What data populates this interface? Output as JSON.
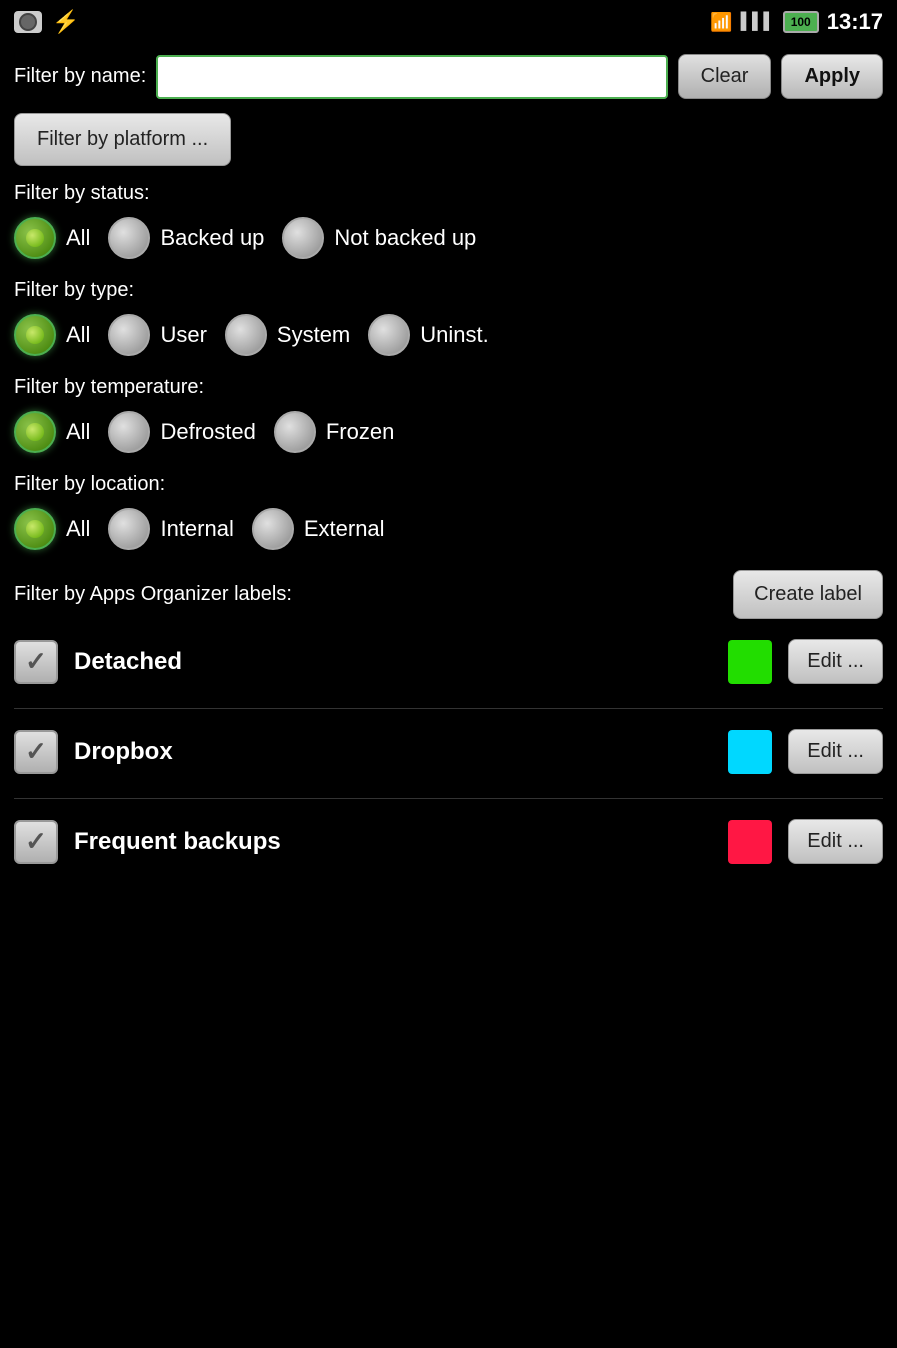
{
  "statusBar": {
    "time": "13:17",
    "battery": "100"
  },
  "header": {
    "filterNameLabel": "Filter by name:",
    "filterNamePlaceholder": "",
    "clearLabel": "Clear",
    "applyLabel": "Apply"
  },
  "platformFilter": {
    "label": "Filter by platform ..."
  },
  "statusFilter": {
    "sectionLabel": "Filter by status:",
    "options": [
      {
        "label": "All",
        "selected": true
      },
      {
        "label": "Backed up",
        "selected": false
      },
      {
        "label": "Not backed up",
        "selected": false
      }
    ]
  },
  "typeFilter": {
    "sectionLabel": "Filter by type:",
    "options": [
      {
        "label": "All",
        "selected": true
      },
      {
        "label": "User",
        "selected": false
      },
      {
        "label": "System",
        "selected": false
      },
      {
        "label": "Uninst.",
        "selected": false
      }
    ]
  },
  "temperatureFilter": {
    "sectionLabel": "Filter by temperature:",
    "options": [
      {
        "label": "All",
        "selected": true
      },
      {
        "label": "Defrosted",
        "selected": false
      },
      {
        "label": "Frozen",
        "selected": false
      }
    ]
  },
  "locationFilter": {
    "sectionLabel": "Filter by location:",
    "options": [
      {
        "label": "All",
        "selected": true
      },
      {
        "label": "Internal",
        "selected": false
      },
      {
        "label": "External",
        "selected": false
      }
    ]
  },
  "labelsSection": {
    "sectionLabel": "Filter by Apps Organizer labels:",
    "createLabelBtn": "Create label",
    "labels": [
      {
        "name": "Detached",
        "color": "#22dd00",
        "editLabel": "Edit ..."
      },
      {
        "name": "Dropbox",
        "color": "#00d8ff",
        "editLabel": "Edit ..."
      },
      {
        "name": "Frequent backups",
        "color": "#ff1744",
        "editLabel": "Edit ..."
      }
    ]
  }
}
